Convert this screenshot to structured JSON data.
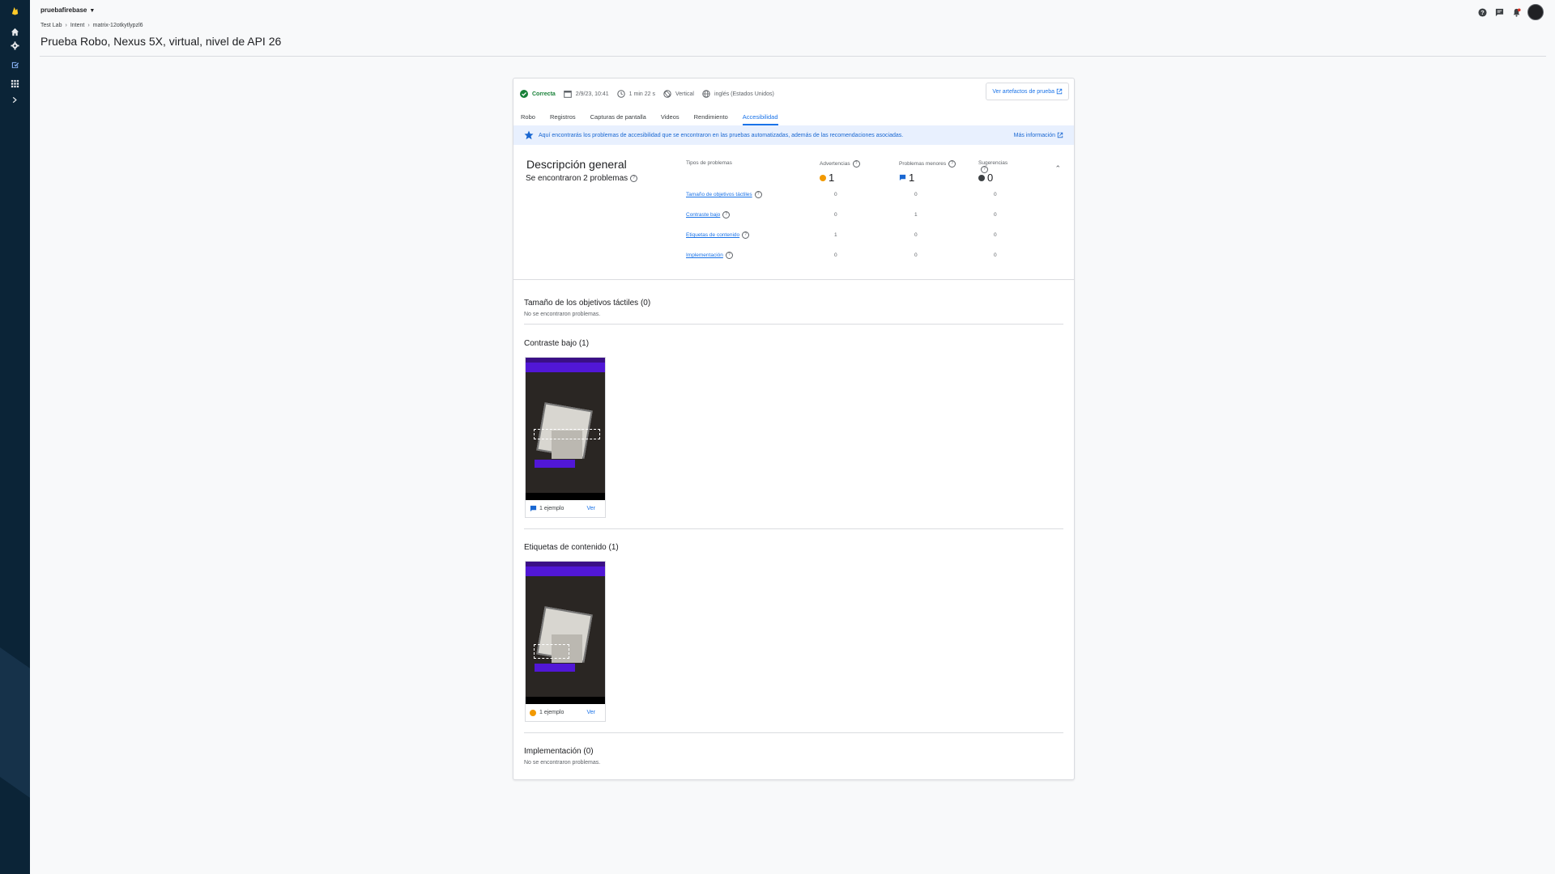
{
  "header": {
    "project": "pruebafirebase",
    "breadcrumb": [
      "Test Lab",
      "Intent",
      "matrix-12otkytlypzl6"
    ],
    "title": "Prueba Robo, Nexus 5X, virtual, nivel de API 26"
  },
  "status": {
    "result": "Correcta",
    "date": "2/9/23, 10:41",
    "duration": "1 min 22 s",
    "orientation": "Vertical",
    "locale": "inglés (Estados Unidos)",
    "artifacts_button": "Ver artefactos de prueba"
  },
  "tabs": [
    "Robo",
    "Registros",
    "Capturas de pantalla",
    "Videos",
    "Rendimiento",
    "Accesibilidad"
  ],
  "active_tab": "Accesibilidad",
  "banner": {
    "text": "Aquí encontrarás los problemas de accesibilidad que se encontraron en las pruebas automatizadas, además de las recomendaciones asociadas.",
    "link": "Más información"
  },
  "overview": {
    "title": "Descripción general",
    "subtitle": "Se encontraron 2 problemas",
    "col_types": "Tipos de problemas",
    "col_warnings": "Advertencias",
    "col_minor": "Problemas menores",
    "col_suggestions": "Sugerencias",
    "warnings_total": "1",
    "minor_total": "1",
    "suggestions_total": "0",
    "rows": [
      {
        "name": "Tamaño de objetivos táctiles",
        "warnings": "0",
        "minor": "0",
        "suggestions": "0"
      },
      {
        "name": "Contraste bajo",
        "warnings": "0",
        "minor": "1",
        "suggestions": "0"
      },
      {
        "name": "Etiquetas de contenido",
        "warnings": "1",
        "minor": "0",
        "suggestions": "0"
      },
      {
        "name": "Implementación",
        "warnings": "0",
        "minor": "0",
        "suggestions": "0"
      }
    ]
  },
  "sections": {
    "touch": {
      "title": "Tamaño de los objetivos táctiles (0)",
      "sub": "No se encontraron problemas."
    },
    "contrast": {
      "title": "Contraste bajo (1)",
      "count": "1 ejemplo",
      "action": "Ver"
    },
    "labels": {
      "title": "Etiquetas de contenido (1)",
      "count": "1 ejemplo",
      "action": "Ver"
    },
    "impl": {
      "title": "Implementación (0)",
      "sub": "No se encontraron problemas."
    }
  },
  "colors": {
    "accent": "#1a73e8",
    "success": "#188038",
    "warning": "#f29900",
    "minor": "#1967d2",
    "suggestion": "#3c4043",
    "rail": "#0b2437"
  }
}
